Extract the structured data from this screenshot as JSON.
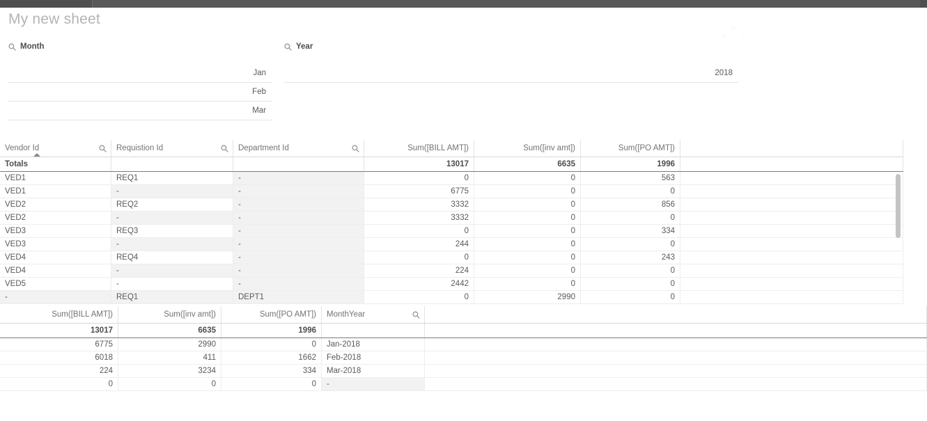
{
  "window": {
    "title": "My new sheet"
  },
  "icons": {
    "search": "search-icon",
    "sort_asc": "sort-ascending-icon",
    "sort_desc": "sort-descending-icon"
  },
  "filters": [
    {
      "id": "month",
      "title": "Month",
      "values": [
        "Jan",
        "Feb",
        "Mar"
      ]
    },
    {
      "id": "year",
      "title": "Year",
      "values": [
        "2018"
      ]
    }
  ],
  "main_table": {
    "columns": [
      {
        "label": "Vendor Id",
        "type": "dim",
        "search": true,
        "sort": "asc"
      },
      {
        "label": "Requistion Id",
        "type": "dim",
        "search": true,
        "sort": "none"
      },
      {
        "label": "Department Id",
        "type": "dim",
        "search": true,
        "sort": "none"
      },
      {
        "label": "Sum([BILL AMT])",
        "type": "measure",
        "search": false,
        "sort": "none"
      },
      {
        "label": "Sum([inv amt])",
        "type": "measure",
        "search": false,
        "sort": "none"
      },
      {
        "label": "Sum([PO AMT])",
        "type": "measure",
        "search": false,
        "sort": "none"
      },
      {
        "label": "",
        "type": "filler",
        "search": false,
        "sort": "none"
      }
    ],
    "totals_label": "Totals",
    "totals": [
      "13017",
      "6635",
      "1996"
    ],
    "rows": [
      {
        "cells": [
          "VED1",
          "REQ1",
          "-",
          "0",
          "0",
          "563"
        ]
      },
      {
        "cells": [
          "VED1",
          "-",
          "-",
          "6775",
          "0",
          "0"
        ]
      },
      {
        "cells": [
          "VED2",
          "REQ2",
          "-",
          "3332",
          "0",
          "856"
        ]
      },
      {
        "cells": [
          "VED2",
          "-",
          "-",
          "3332",
          "0",
          "0"
        ]
      },
      {
        "cells": [
          "VED3",
          "REQ3",
          "-",
          "0",
          "0",
          "334"
        ]
      },
      {
        "cells": [
          "VED3",
          "-",
          "-",
          "244",
          "0",
          "0"
        ]
      },
      {
        "cells": [
          "VED4",
          "REQ4",
          "-",
          "0",
          "0",
          "243"
        ]
      },
      {
        "cells": [
          "VED4",
          "-",
          "-",
          "224",
          "0",
          "0"
        ]
      },
      {
        "cells": [
          "VED5",
          "-",
          "-",
          "2442",
          "0",
          "0"
        ]
      },
      {
        "cells": [
          "-",
          "REQ1",
          "DEPT1",
          "0",
          "2990",
          "0"
        ]
      }
    ]
  },
  "bottom_table": {
    "columns": [
      {
        "label": "Sum([BILL AMT])",
        "type": "measure",
        "search": false,
        "sort": "desc"
      },
      {
        "label": "Sum([inv amt])",
        "type": "measure",
        "search": false,
        "sort": "none"
      },
      {
        "label": "Sum([PO AMT])",
        "type": "measure",
        "search": false,
        "sort": "none"
      },
      {
        "label": "MonthYear",
        "type": "dim",
        "search": true,
        "sort": "none"
      },
      {
        "label": "",
        "type": "filler",
        "search": false,
        "sort": "none"
      }
    ],
    "totals": [
      "13017",
      "6635",
      "1996",
      ""
    ],
    "rows": [
      {
        "cells": [
          "6775",
          "2990",
          "0",
          "Jan-2018"
        ]
      },
      {
        "cells": [
          "6018",
          "411",
          "1662",
          "Feb-2018"
        ]
      },
      {
        "cells": [
          "224",
          "3234",
          "334",
          "Mar-2018"
        ]
      },
      {
        "cells": [
          "0",
          "0",
          "0",
          "-"
        ]
      }
    ]
  },
  "colors": {
    "topbar": "#595959",
    "title_text": "#b4b4b4",
    "header_text": "#737373",
    "body_text": "#5a5a5a",
    "shaded_cell": "#f2f2f2",
    "grid_line": "#ededed",
    "totals_border": "#7b7b7b",
    "scrollbar": "#c4c4c4"
  }
}
